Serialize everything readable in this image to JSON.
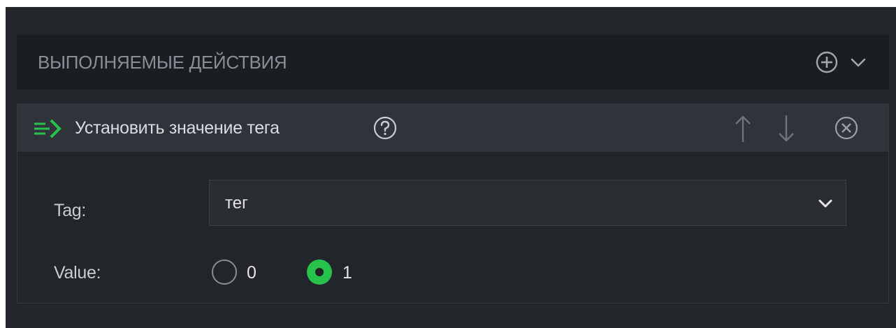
{
  "section": {
    "title": "ВЫПОЛНЯЕМЫЕ ДЕЙСТВИЯ",
    "add_icon": "plus-circle-icon",
    "collapse_icon": "chevron-down-icon"
  },
  "action": {
    "icon": "arrow-right-lines-icon",
    "title": "Установить значение тега",
    "help_icon": "question-circle-icon",
    "move_up_icon": "arrow-up-icon",
    "move_down_icon": "arrow-down-icon",
    "remove_icon": "close-circle-icon"
  },
  "fields": {
    "tag_label": "Tag:",
    "tag_value": "тег",
    "value_label": "Value:",
    "value_options": [
      "0",
      "1"
    ],
    "value_selected": "1"
  },
  "colors": {
    "accent_green": "#27c24c",
    "header_bg": "#1a1d21",
    "panel_bg": "#22252a",
    "action_bar_bg": "#30343a"
  }
}
